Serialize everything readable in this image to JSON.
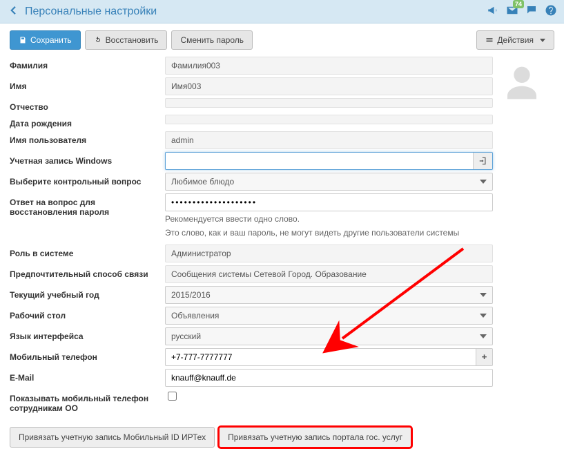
{
  "header": {
    "title": "Персональные настройки",
    "mail_badge": "74"
  },
  "toolbar": {
    "save_label": "Сохранить",
    "restore_label": "Восстановить",
    "change_password_label": "Сменить пароль",
    "actions_label": "Действия"
  },
  "form": {
    "lastname_label": "Фамилия",
    "lastname_value": "Фамилия003",
    "firstname_label": "Имя",
    "firstname_value": "Имя003",
    "patronymic_label": "Отчество",
    "patronymic_value": "",
    "birthdate_label": "Дата рождения",
    "birthdate_value": "",
    "username_label": "Имя пользователя",
    "username_value": "admin",
    "windows_account_label": "Учетная запись Windows",
    "windows_account_value": "",
    "security_question_label": "Выберите контрольный вопрос",
    "security_question_value": "Любимое блюдо",
    "security_answer_label": "Ответ на вопрос для восстановления пароля",
    "security_answer_value": "••••••••••••••••••••",
    "hint_line1": "Рекомендуется ввести одно слово.",
    "hint_line2": "Это слово, как и ваш пароль, не могут видеть другие пользователи системы",
    "role_label": "Роль в системе",
    "role_value": "Администратор",
    "contact_label": "Предпочтительный способ связи",
    "contact_value": "Сообщения системы Сетевой Город. Образование",
    "school_year_label": "Текущий учебный год",
    "school_year_value": "2015/2016",
    "desktop_label": "Рабочий стол",
    "desktop_value": "Объявления",
    "language_label": "Язык интерфейса",
    "language_value": "русский",
    "mobile_label": "Мобильный телефон",
    "mobile_value": "+7-777-7777777",
    "email_label": "E-Mail",
    "email_value": "knauff@knauff.de",
    "show_mobile_label": "Показывать мобильный телефон сотрудникам ОО",
    "show_mobile_checked": false
  },
  "bottom": {
    "link_irtech_label": "Привязать учетную запись Мобильный ID ИРТех",
    "link_gosuslugi_label": "Привязать учетную запись портала гос. услуг"
  }
}
